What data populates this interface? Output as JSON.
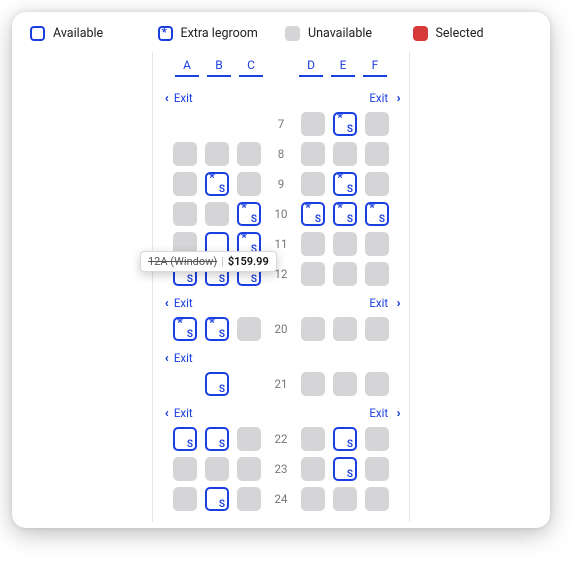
{
  "legend": {
    "available": "Available",
    "legroom": "Extra legroom",
    "unavailable": "Unavailable",
    "selected": "Selected"
  },
  "columns": {
    "left": [
      "A",
      "B",
      "C"
    ],
    "right": [
      "D",
      "E",
      "F"
    ]
  },
  "exit_label": "Exit",
  "tooltip": {
    "label": "12A (Window)",
    "price": "$159.99"
  },
  "rows": {
    "r7": [
      "blank",
      "blank",
      "blank",
      "unavailable",
      "legroom-paid",
      "unavailable"
    ],
    "r8": [
      "unavailable",
      "unavailable",
      "unavailable",
      "unavailable",
      "unavailable",
      "unavailable"
    ],
    "r9": [
      "unavailable",
      "legroom-paid",
      "unavailable",
      "unavailable",
      "legroom-paid",
      "unavailable"
    ],
    "r10": [
      "unavailable",
      "unavailable",
      "legroom-paid",
      "legroom-paid",
      "legroom-paid",
      "legroom-paid"
    ],
    "r11": [
      "unavailable",
      "available-plain",
      "legroom-paid",
      "unavailable",
      "unavailable",
      "unavailable"
    ],
    "r12": [
      "legroom-paid",
      "legroom-paid",
      "legroom-paid",
      "unavailable",
      "unavailable",
      "unavailable"
    ],
    "r20": [
      "legroom-paid",
      "legroom-paid",
      "unavailable",
      "unavailable",
      "unavailable",
      "unavailable"
    ],
    "r21": [
      "blank",
      "available-paid",
      "blank",
      "unavailable",
      "unavailable",
      "unavailable"
    ],
    "r22": [
      "available-paid",
      "available-paid",
      "unavailable",
      "unavailable",
      "available-paid",
      "unavailable"
    ],
    "r23": [
      "unavailable",
      "unavailable",
      "unavailable",
      "unavailable",
      "available-paid",
      "unavailable"
    ],
    "r24": [
      "unavailable",
      "available-paid",
      "unavailable",
      "unavailable",
      "unavailable",
      "unavailable"
    ]
  },
  "row_labels": {
    "r7": "7",
    "r8": "8",
    "r9": "9",
    "r10": "10",
    "r11": "11",
    "r12": "12",
    "r20": "20",
    "r21": "21",
    "r22": "22",
    "r23": "23",
    "r24": "24"
  }
}
